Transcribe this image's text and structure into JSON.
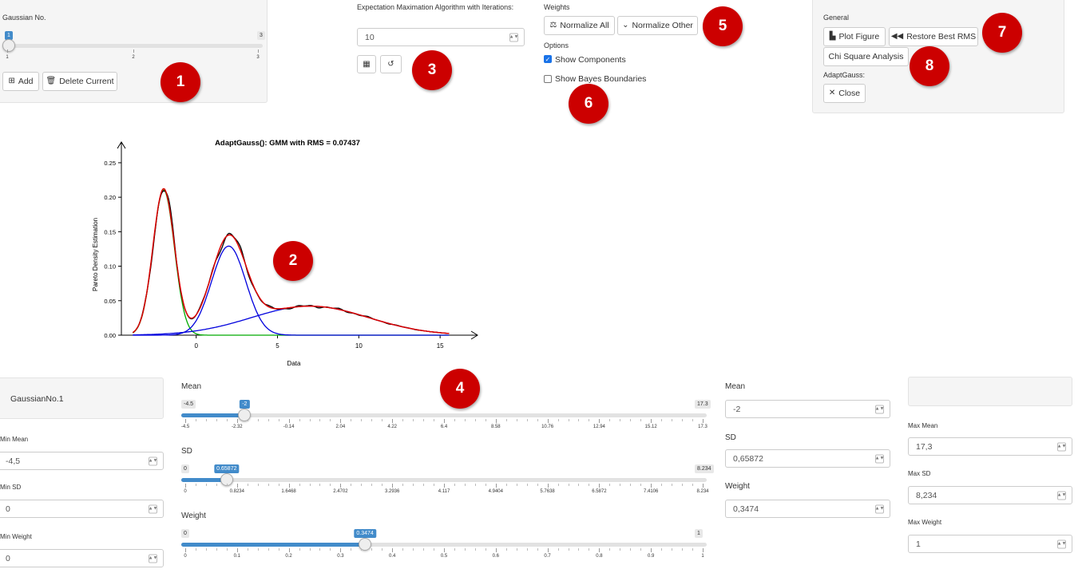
{
  "gaussian_panel": {
    "label": "Gaussian No.",
    "slider": {
      "min": "1",
      "max": "3",
      "value": "1",
      "ticks": [
        "1",
        "2",
        "3"
      ],
      "fraction": 0.0
    },
    "add_label": "Add",
    "delete_label": "Delete Current"
  },
  "em": {
    "label": "Expectation Maximation Algorithm with Iterations:",
    "iterations": "10"
  },
  "weights": {
    "label": "Weights",
    "normalize_all": "Normalize All",
    "normalize_other": "Normalize Other"
  },
  "options": {
    "label": "Options",
    "show_components": "Show Components",
    "show_components_checked": true,
    "show_bayes": "Show Bayes Boundaries",
    "show_bayes_checked": false
  },
  "general": {
    "label": "General",
    "plot_figure": "Plot Figure",
    "restore_best": "Restore Best RMS",
    "chi_square": "Chi Square Analysis",
    "adaptgauss_label": "AdaptGauss:",
    "close": "Close"
  },
  "badges": [
    "1",
    "2",
    "3",
    "4",
    "5",
    "6",
    "7",
    "8"
  ],
  "chart_data": {
    "type": "line",
    "title": "AdaptGauss(): GMM with RMS =  0.07437",
    "xlabel": "Data",
    "ylabel": "Pareto Density Estimation",
    "x_ticks": [
      "0",
      "5",
      "10",
      "15"
    ],
    "y_ticks": [
      "0.00",
      "0.05",
      "0.10",
      "0.15",
      "0.20",
      "0.25"
    ],
    "xlim": [
      -4.6,
      17.3
    ],
    "ylim": [
      0,
      0.28
    ],
    "components": [
      {
        "mean": -2,
        "sd": 0.65872,
        "weight": 0.3474,
        "color": "#00aa00"
      },
      {
        "mean": 2,
        "sd": 1.05,
        "weight": 0.34,
        "color": "#0000dd"
      },
      {
        "mean": 7,
        "sd": 3.6,
        "weight": 0.38,
        "color": "#0000dd"
      }
    ],
    "mixture_color": "#dd0000",
    "data_color": "#000000"
  },
  "current": {
    "name": "GaussianNo.1",
    "min_mean_label": "Min Mean",
    "min_mean": "-4,5",
    "min_sd_label": "Min SD",
    "min_sd": "0",
    "min_weight_label": "Min Weight",
    "min_weight": "0",
    "mean_label": "Mean",
    "mean_slider": {
      "min": "-4.5",
      "max": "17.3",
      "value": "-2",
      "fraction": 0.1147,
      "ticks": [
        "-4.5",
        "-2.32",
        "-0.14",
        "2.04",
        "4.22",
        "6.4",
        "8.58",
        "10.76",
        "12.94",
        "15.12",
        "17.3"
      ]
    },
    "sd_label": "SD",
    "sd_slider": {
      "min": "0",
      "max": "8.234",
      "value": "0.65872",
      "fraction": 0.08,
      "ticks": [
        "0",
        "0.8234",
        "1.6468",
        "2.4702",
        "3.2936",
        "4.117",
        "4.9404",
        "5.7638",
        "6.5872",
        "7.4106",
        "8.234"
      ]
    },
    "weight_label": "Weight",
    "weight_slider": {
      "min": "0",
      "max": "1",
      "value": "0.3474",
      "fraction": 0.3474,
      "ticks": [
        "0",
        "0.1",
        "0.2",
        "0.3",
        "0.4",
        "0.5",
        "0.6",
        "0.7",
        "0.8",
        "0.9",
        "1"
      ]
    },
    "mean_value": "-2",
    "sd_value": "0,65872",
    "weight_value": "0,3474",
    "max_mean_label": "Max Mean",
    "max_mean": "17,3",
    "max_sd_label": "Max SD",
    "max_sd": "8,234",
    "max_weight_label": "Max Weight",
    "max_weight": "1"
  }
}
